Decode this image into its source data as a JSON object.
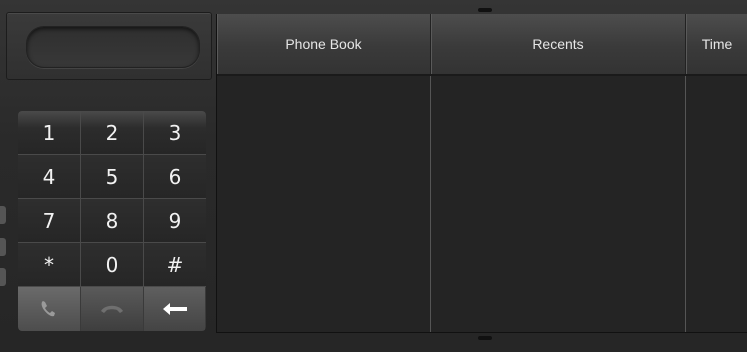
{
  "dialer": {
    "number_value": "",
    "keys": [
      {
        "label": "1",
        "name": "key-1"
      },
      {
        "label": "2",
        "name": "key-2"
      },
      {
        "label": "3",
        "name": "key-3"
      },
      {
        "label": "4",
        "name": "key-4"
      },
      {
        "label": "5",
        "name": "key-5"
      },
      {
        "label": "6",
        "name": "key-6"
      },
      {
        "label": "7",
        "name": "key-7"
      },
      {
        "label": "8",
        "name": "key-8"
      },
      {
        "label": "9",
        "name": "key-9"
      },
      {
        "label": "*",
        "name": "key-star"
      },
      {
        "label": "0",
        "name": "key-0"
      },
      {
        "label": "#",
        "name": "key-hash"
      }
    ],
    "actions": {
      "call_icon": "phone-call-icon",
      "hangup_icon": "phone-hangup-icon",
      "backspace_icon": "backspace-arrow-icon"
    }
  },
  "table": {
    "headers": [
      "Phone Book",
      "Recents",
      "Time"
    ]
  }
}
